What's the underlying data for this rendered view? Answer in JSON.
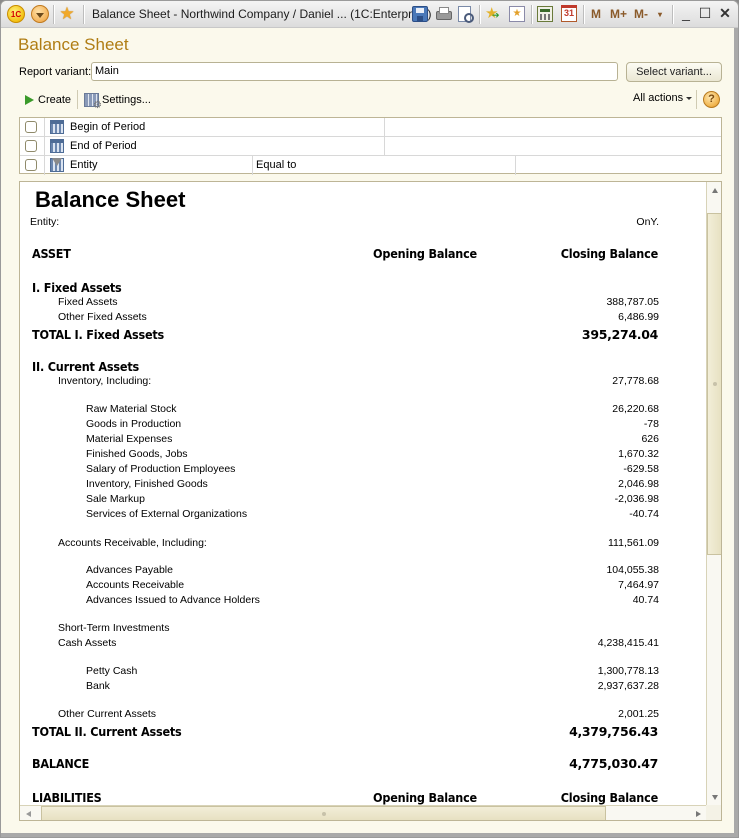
{
  "window": {
    "title": "Balance Sheet - Northwind Company / Daniel ...  (1C:Enterprise)",
    "logo_text": "1C",
    "toolbar_icons": [
      "save-icon",
      "print-icon",
      "print-preview-icon",
      "add-to-favorites-icon",
      "favorites-icon",
      "calculator-icon",
      "calendar-icon"
    ],
    "calendar_day": "31",
    "memory_buttons": [
      "M",
      "M+",
      "M-"
    ],
    "controls": {
      "minimize": "_",
      "maximize": "☐",
      "close": "✕"
    },
    "fav_star": "★"
  },
  "form": {
    "title": "Balance Sheet",
    "report_variant_label": "Report variant:",
    "report_variant_value": "Main",
    "select_variant_label": "Select variant...",
    "commands": {
      "create": "Create",
      "settings": "Settings...",
      "all_actions": "All actions",
      "help": "?"
    }
  },
  "settings": [
    {
      "label": "Begin of Period",
      "icon": "period-icon",
      "checked": false,
      "condition": "",
      "value": ""
    },
    {
      "label": "End of Period",
      "icon": "period-icon",
      "checked": false,
      "condition": "",
      "value": ""
    },
    {
      "label": "Entity",
      "icon": "filter-icon",
      "checked": false,
      "condition": "Equal to",
      "value": ""
    }
  ],
  "report": {
    "title": "Balance Sheet",
    "entity_label": "Entity:",
    "units": "OnY.",
    "asset_header": {
      "label": "ASSET",
      "opening": "Opening Balance",
      "closing": "Closing Balance"
    },
    "fixed": {
      "title": "I. Fixed Assets",
      "items": [
        {
          "label": "Fixed Assets",
          "closing": "388,787.05"
        },
        {
          "label": "Other Fixed Assets",
          "closing": "6,486.99"
        }
      ],
      "total_label": "TOTAL I. Fixed Assets",
      "total": "395,274.04"
    },
    "current": {
      "title": "II. Current Assets",
      "inventory": {
        "label": "Inventory, Including:",
        "closing": "27,778.68"
      },
      "inventory_items": [
        {
          "label": "Raw Material Stock",
          "closing": "26,220.68"
        },
        {
          "label": "Goods in Production",
          "closing": "-78"
        },
        {
          "label": "Material Expenses",
          "closing": "626"
        },
        {
          "label": "Finished Goods, Jobs",
          "closing": "1,670.32"
        },
        {
          "label": "Salary of Production Employees",
          "closing": "-629.58"
        },
        {
          "label": "Inventory, Finished Goods",
          "closing": "2,046.98"
        },
        {
          "label": "Sale Markup",
          "closing": "-2,036.98"
        },
        {
          "label": "Services of External Organizations",
          "closing": "-40.74"
        }
      ],
      "receivable": {
        "label": "Accounts Receivable, Including:",
        "closing": "111,561.09"
      },
      "receivable_items": [
        {
          "label": "Advances Payable",
          "closing": "104,055.38"
        },
        {
          "label": "Accounts Receivable",
          "closing": "7,464.97"
        },
        {
          "label": "Advances Issued to Advance Holders",
          "closing": "40.74"
        }
      ],
      "short_term": {
        "label": "Short-Term Investments",
        "closing": ""
      },
      "cash": {
        "label": "Cash Assets",
        "closing": "4,238,415.41"
      },
      "cash_items": [
        {
          "label": "Petty Cash",
          "closing": "1,300,778.13"
        },
        {
          "label": "Bank",
          "closing": "2,937,637.28"
        }
      ],
      "other": {
        "label": "Other Current Assets",
        "closing": "2,001.25"
      },
      "total_label": "TOTAL II. Current Assets",
      "total": "4,379,756.43"
    },
    "balance": {
      "label": "BALANCE",
      "closing": "4,775,030.47"
    },
    "liabilities_header": {
      "label": "LIABILITIES",
      "opening": "Opening Balance",
      "closing": "Closing Balance"
    }
  },
  "colors": {
    "form_background": "#fbf9ec",
    "form_title": "#b07d14",
    "border": "#bdb596"
  }
}
